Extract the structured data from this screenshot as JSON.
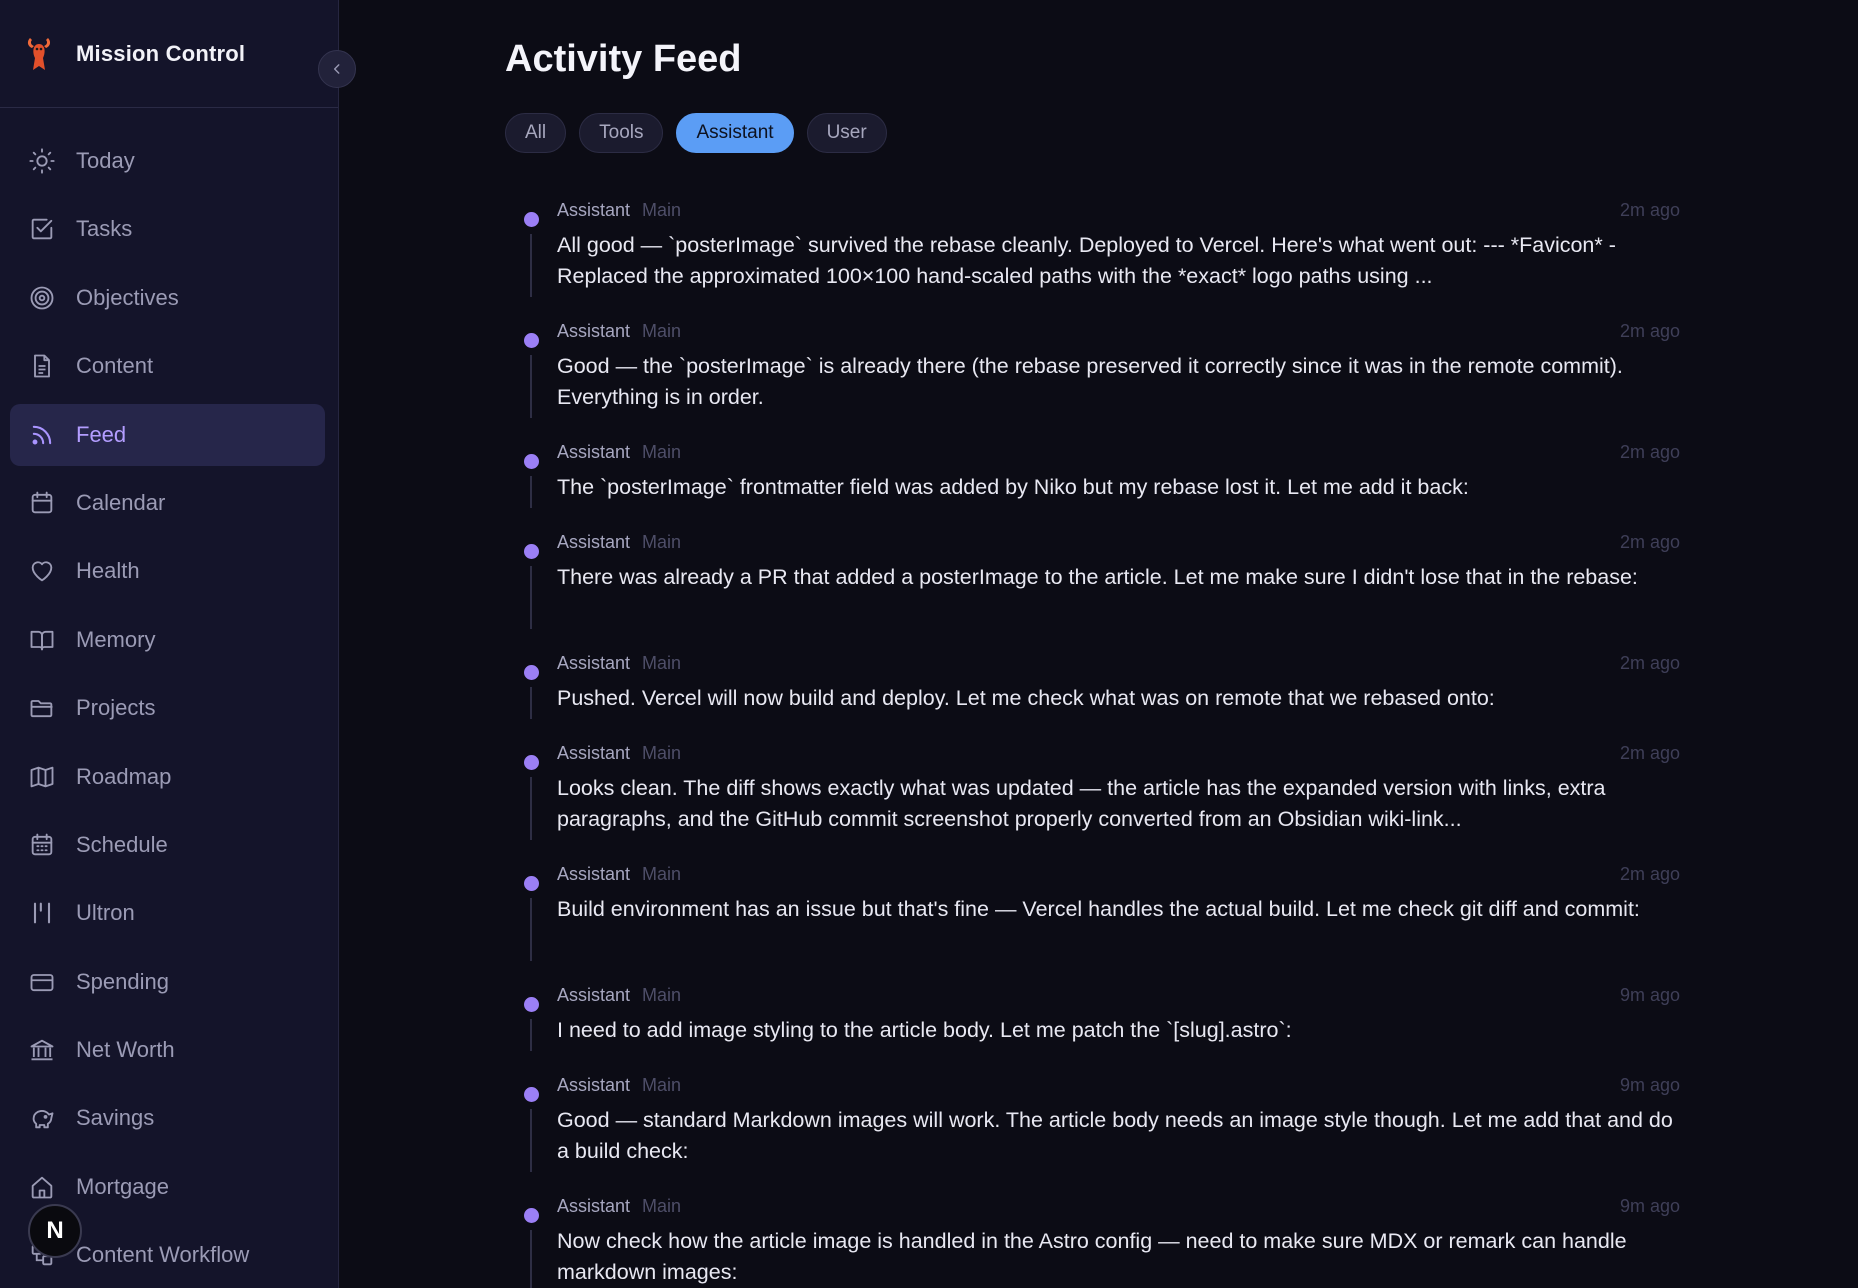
{
  "brand": {
    "title": "Mission Control"
  },
  "sidebar": {
    "items": [
      {
        "label": "Today",
        "icon": "sun-icon",
        "active": false
      },
      {
        "label": "Tasks",
        "icon": "checkbox-icon",
        "active": false
      },
      {
        "label": "Objectives",
        "icon": "target-icon",
        "active": false
      },
      {
        "label": "Content",
        "icon": "document-icon",
        "active": false
      },
      {
        "label": "Feed",
        "icon": "rss-icon",
        "active": true
      },
      {
        "label": "Calendar",
        "icon": "calendar-icon",
        "active": false
      },
      {
        "label": "Health",
        "icon": "heart-icon",
        "active": false
      },
      {
        "label": "Memory",
        "icon": "book-icon",
        "active": false
      },
      {
        "label": "Projects",
        "icon": "folder-icon",
        "active": false
      },
      {
        "label": "Roadmap",
        "icon": "map-icon",
        "active": false
      },
      {
        "label": "Schedule",
        "icon": "calendar-grid-icon",
        "active": false
      },
      {
        "label": "Ultron",
        "icon": "bars-icon",
        "active": false
      },
      {
        "label": "Spending",
        "icon": "credit-card-icon",
        "active": false
      },
      {
        "label": "Net Worth",
        "icon": "bank-icon",
        "active": false
      },
      {
        "label": "Savings",
        "icon": "piggy-bank-icon",
        "active": false
      },
      {
        "label": "Mortgage",
        "icon": "house-icon",
        "active": false
      },
      {
        "label": "Content Workflow",
        "icon": "workflow-icon",
        "active": false
      }
    ]
  },
  "avatar": {
    "initial": "N"
  },
  "main": {
    "title": "Activity Feed",
    "filters": [
      {
        "label": "All",
        "active": false
      },
      {
        "label": "Tools",
        "active": false
      },
      {
        "label": "Assistant",
        "active": true
      },
      {
        "label": "User",
        "active": false
      }
    ],
    "entries": [
      {
        "role": "Assistant",
        "source": "Main",
        "time": "2m ago",
        "text": "All good — `posterImage` survived the rebase cleanly. Deployed to Vercel. Here's what went out: --- *Favicon* - Replaced the approximated 100×100 hand-scaled paths with the *exact* logo paths using ..."
      },
      {
        "role": "Assistant",
        "source": "Main",
        "time": "2m ago",
        "text": "Good — the `posterImage` is already there (the rebase preserved it correctly since it was in the remote commit). Everything is in order."
      },
      {
        "role": "Assistant",
        "source": "Main",
        "time": "2m ago",
        "text": "The `posterImage` frontmatter field was added by Niko but my rebase lost it. Let me add it back:"
      },
      {
        "role": "Assistant",
        "source": "Main",
        "time": "2m ago",
        "text": "There was already a PR that added a posterImage to the article. Let me make sure I didn't lose that in the rebase:"
      },
      {
        "role": "Assistant",
        "source": "Main",
        "time": "2m ago",
        "text": "Pushed. Vercel will now build and deploy. Let me check what was on remote that we rebased onto:"
      },
      {
        "role": "Assistant",
        "source": "Main",
        "time": "2m ago",
        "text": "Looks clean. The diff shows exactly what was updated — the article has the expanded version with links, extra paragraphs, and the GitHub commit screenshot properly converted from an Obsidian wiki-link..."
      },
      {
        "role": "Assistant",
        "source": "Main",
        "time": "2m ago",
        "text": "Build environment has an issue but that's fine — Vercel handles the actual build. Let me check git diff and commit:"
      },
      {
        "role": "Assistant",
        "source": "Main",
        "time": "9m ago",
        "text": "I need to add image styling to the article body. Let me patch the `[slug].astro`:"
      },
      {
        "role": "Assistant",
        "source": "Main",
        "time": "9m ago",
        "text": "Good — standard Markdown images will work. The article body needs an image style though. Let me add that and do a build check:"
      },
      {
        "role": "Assistant",
        "source": "Main",
        "time": "9m ago",
        "text": "Now check how the article image is handled in the Astro config — need to make sure MDX or remark can handle markdown images:"
      }
    ]
  },
  "colors": {
    "accent_purple": "#a994ff",
    "filter_active": "#5b9df5",
    "dot": "#9b7ff5",
    "background": "#0c0c15",
    "sidebar": "#14142a"
  }
}
